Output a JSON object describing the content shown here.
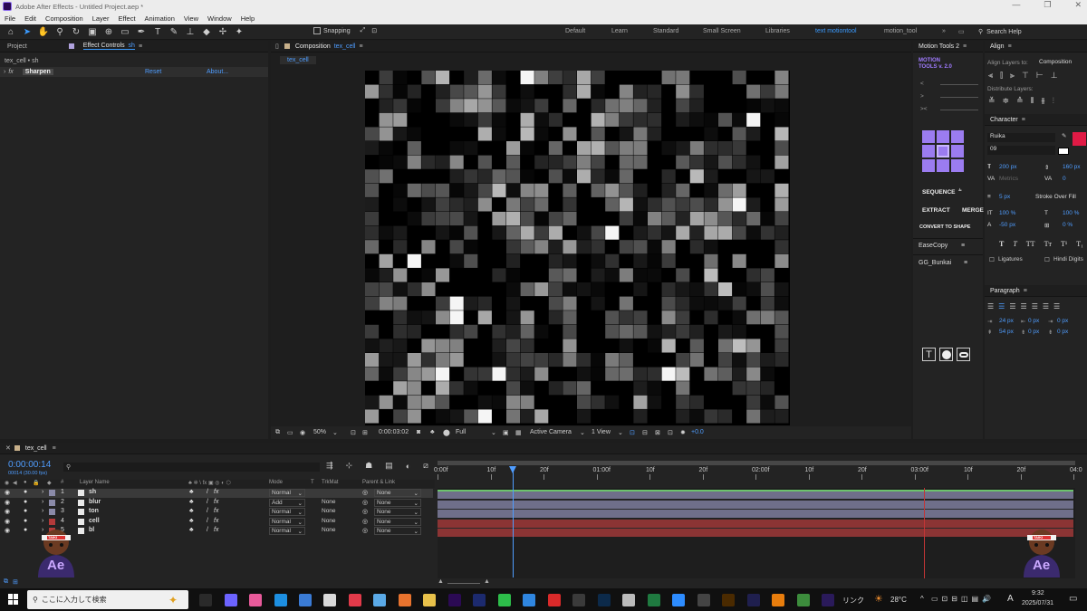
{
  "window": {
    "title": "Adobe After Effects - Untitled Project.aep *"
  },
  "menu": [
    "File",
    "Edit",
    "Composition",
    "Layer",
    "Effect",
    "Animation",
    "View",
    "Window",
    "Help"
  ],
  "toolbar": {
    "snapping": "Snapping",
    "workspaces": [
      "Default",
      "Learn",
      "Standard",
      "Small Screen",
      "Libraries",
      "text motiontool",
      "motion_tool"
    ],
    "active_workspace": "text motiontool",
    "search_placeholder": "Search Help"
  },
  "left_panel": {
    "tab_project": "Project",
    "tab_effect_controls": "Effect Controls",
    "tab_effect_layer": "sh",
    "breadcrumb": "tex_cell • sh",
    "effect_name": "Sharpen",
    "reset": "Reset",
    "about": "About..."
  },
  "comp_panel": {
    "tab_label": "Composition",
    "tab_comp": "tex_cell",
    "subtab": "tex_cell",
    "zoom": "50%",
    "timecode": "0:00:03:02",
    "resolution": "Full",
    "camera": "Active Camera",
    "views": "1 View",
    "exposure": "+0.0"
  },
  "motion_tools": {
    "tab": "Motion Tools 2",
    "logo_line1": "MOTION",
    "logo_line2": "TOOLS v. 2.0",
    "sequence": "SEQUENCE",
    "extract": "EXTRACT",
    "merge": "MERGE",
    "convert": "CONVERT TO SHAPE",
    "easecopy": "EaseCopy",
    "gg_bunkai": "GG_Bunkai"
  },
  "align_panel": {
    "tab": "Align",
    "align_to_label": "Align Layers to:",
    "align_to_value": "Composition",
    "distribute": "Distribute Layers:"
  },
  "character_panel": {
    "tab": "Character",
    "font": "Ruika",
    "style": "09",
    "size": "200 px",
    "leading": "160 px",
    "kerning": "Metrics",
    "tracking": "0",
    "stroke_size": "5 px",
    "stroke_mode": "Stroke Over Fill",
    "vscale": "100 %",
    "hscale": "100 %",
    "baseline": "-50 px",
    "tsume": "0 %",
    "ligatures": "Ligatures",
    "hindi": "Hindi Digits",
    "fill_color": "#e01a45"
  },
  "paragraph_panel": {
    "tab": "Paragraph",
    "indent_left": "24 px",
    "indent_right": "0 px",
    "space_before": "54 px",
    "space_after": "0 px",
    "first_line": "0 px",
    "space_after2": "0 px"
  },
  "timeline": {
    "tab": "tex_cell",
    "timecode": "0:00:00:14",
    "fps": "00014 (30.00 fps)",
    "columns": {
      "layer_name": "Layer Name",
      "mode": "Mode",
      "t": "T",
      "trkmat": "TrkMat",
      "parent": "Parent & Link"
    },
    "layers": [
      {
        "num": "1",
        "name": "sh",
        "mode": "Normal",
        "trkmat": "",
        "parent": "None",
        "label": "#8a8aa8",
        "bar": "#6f6f8a"
      },
      {
        "num": "2",
        "name": "blur",
        "mode": "Add",
        "trkmat": "None",
        "parent": "None",
        "label": "#8a8aa8",
        "bar": "#6f6f8a"
      },
      {
        "num": "3",
        "name": "ton",
        "mode": "Normal",
        "trkmat": "None",
        "parent": "None",
        "label": "#8a8aa8",
        "bar": "#6f6f8a"
      },
      {
        "num": "4",
        "name": "cell",
        "mode": "Normal",
        "trkmat": "None",
        "parent": "None",
        "label": "#b23a3a",
        "bar": "#8b3434"
      },
      {
        "num": "5",
        "name": "bl",
        "mode": "Normal",
        "trkmat": "None",
        "parent": "None",
        "label": "#b23a3a",
        "bar": "#8b3434"
      }
    ],
    "ruler": [
      "0:00f",
      "10f",
      "20f",
      "01:00f",
      "10f",
      "20f",
      "02:00f",
      "10f",
      "20f",
      "03:00f",
      "10f",
      "20f",
      "04:0"
    ]
  },
  "taskbar": {
    "search": "ここに入力して検索",
    "link": "リンク",
    "temp": "28°C",
    "ime": "A",
    "time": "9:32",
    "date": "2025/07/31"
  },
  "mascot": {
    "name": "Ae",
    "headband": "TAIKI"
  }
}
